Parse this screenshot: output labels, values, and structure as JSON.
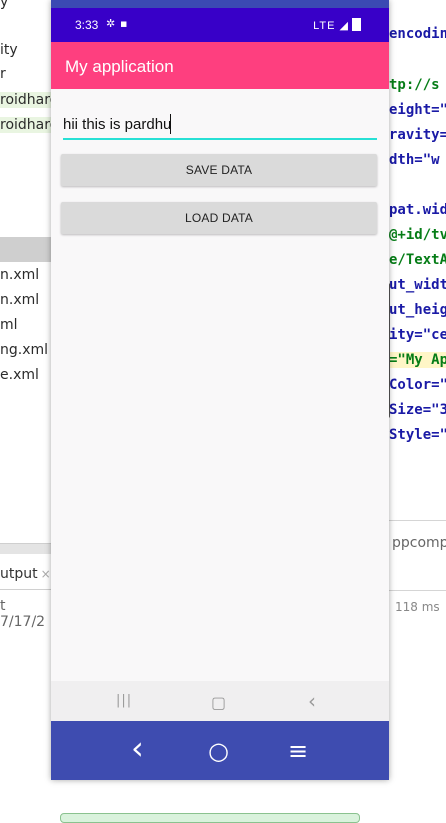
{
  "ide_left": {
    "lines": [
      {
        "text": "y"
      },
      {
        "text": "ity"
      },
      {
        "text": "r"
      },
      {
        "text": "roidhard"
      },
      {
        "text": "roidhard"
      }
    ],
    "files": [
      {
        "text": "n.xml"
      },
      {
        "text": "n.xml"
      },
      {
        "text": "ml"
      },
      {
        "text": "ng.xml"
      },
      {
        "text": "e.xml"
      }
    ],
    "output_tab": "utput",
    "output_close": "×",
    "output_line": "t 7/17/2"
  },
  "ide_right": {
    "code_lines": [
      "encodin",
      "",
      "tp://s",
      "eight=\"",
      "ravity=",
      "dth=\"w",
      "",
      "pat.wid",
      "@+id/tv",
      "e/TextA",
      "ut_widt",
      "ut_heig",
      "ity=\"ce",
      "=\"My Ap",
      "Color=\"",
      "Size=\"3",
      "Style=\""
    ],
    "compat_text": "ppcomp",
    "time_text": "118 ms"
  },
  "phone": {
    "status_time": "3:33",
    "status_right": "LTE",
    "app_title": "My application",
    "edit_value": "hii this is pardhu",
    "save_label": "SAVE DATA",
    "load_label": "LOAD DATA",
    "soft_nav": {
      "recents": "|||",
      "home": "▢",
      "back": "‹"
    },
    "emu_nav": {
      "back": "‹",
      "home": "○",
      "menu": "≡"
    },
    "colors": {
      "status_bar": "#3800c8",
      "app_bar": "#fe3f7f",
      "edit_underline": "#28e0d5",
      "emulator_nav": "#3e4cb0"
    }
  }
}
